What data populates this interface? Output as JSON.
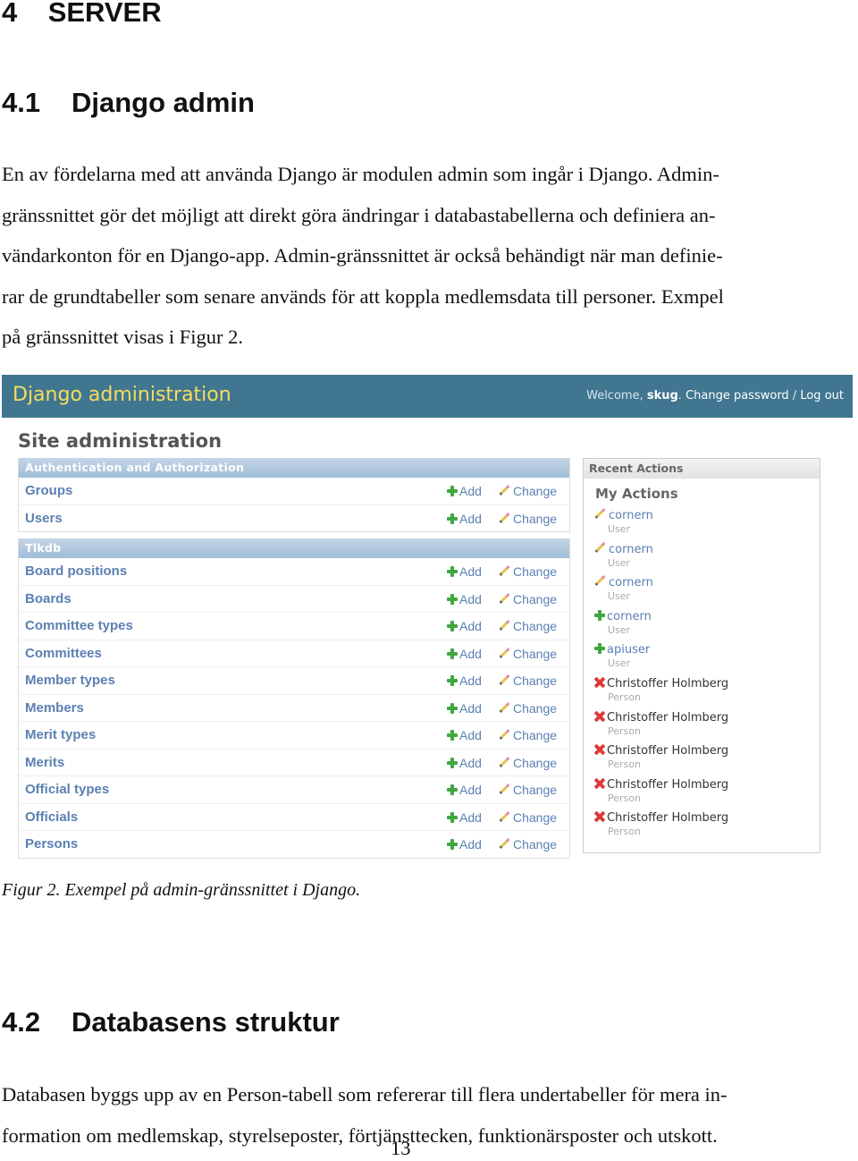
{
  "document": {
    "chapter": {
      "number": "4",
      "title": "SERVER"
    },
    "section1": {
      "number": "4.1",
      "title": "Django admin",
      "paragraph_lines": [
        "En av fördelarna med att använda Django är modulen admin som ingår i Django. Admin-",
        "gränssnittet gör det möjligt att direkt göra ändringar i databastabellerna och definiera an-",
        "vändarkonton för en Django-app. Admin-gränssnittet är också behändigt när man definie-",
        "rar de grundtabeller som senare används för att koppla medlemsdata till personer. Exmpel",
        "på gränssnittet visas i Figur 2."
      ]
    },
    "figure_caption": "Figur 2. Exempel på admin-gränssnittet i Django.",
    "section2": {
      "number": "4.2",
      "title": "Databasens struktur",
      "paragraph_lines": [
        "Databasen byggs upp av en Person-tabell som refererar till flera undertabeller för mera in-",
        "formation om medlemskap, styrelseposter, förtjänsttecken, funktionärsposter och utskott."
      ]
    },
    "page_number": "13"
  },
  "admin": {
    "brand": "Django administration",
    "welcome_prefix": "Welcome, ",
    "username": "skug",
    "welcome_suffix": ". ",
    "change_password": "Change password",
    "separator": " / ",
    "log_out": "Log out",
    "site_title": "Site administration",
    "add_label": "Add",
    "change_label": "Change",
    "modules": [
      {
        "caption": "Authentication and Authorization",
        "models": [
          "Groups",
          "Users"
        ]
      },
      {
        "caption": "Tlkdb",
        "models": [
          "Board positions",
          "Boards",
          "Committee types",
          "Committees",
          "Member types",
          "Members",
          "Merit types",
          "Merits",
          "Official types",
          "Officials",
          "Persons"
        ]
      }
    ],
    "recent_actions": {
      "caption": "Recent Actions",
      "subtitle": "My Actions",
      "items": [
        {
          "action": "change",
          "object": "cornern",
          "type": "User"
        },
        {
          "action": "change",
          "object": "cornern",
          "type": "User"
        },
        {
          "action": "change",
          "object": "cornern",
          "type": "User"
        },
        {
          "action": "add",
          "object": "cornern",
          "type": "User"
        },
        {
          "action": "add",
          "object": "apiuser",
          "type": "User"
        },
        {
          "action": "delete",
          "object": "Christoffer Holmberg",
          "type": "Person"
        },
        {
          "action": "delete",
          "object": "Christoffer Holmberg",
          "type": "Person"
        },
        {
          "action": "delete",
          "object": "Christoffer Holmberg",
          "type": "Person"
        },
        {
          "action": "delete",
          "object": "Christoffer Holmberg",
          "type": "Person"
        },
        {
          "action": "delete",
          "object": "Christoffer Holmberg",
          "type": "Person"
        }
      ]
    }
  }
}
